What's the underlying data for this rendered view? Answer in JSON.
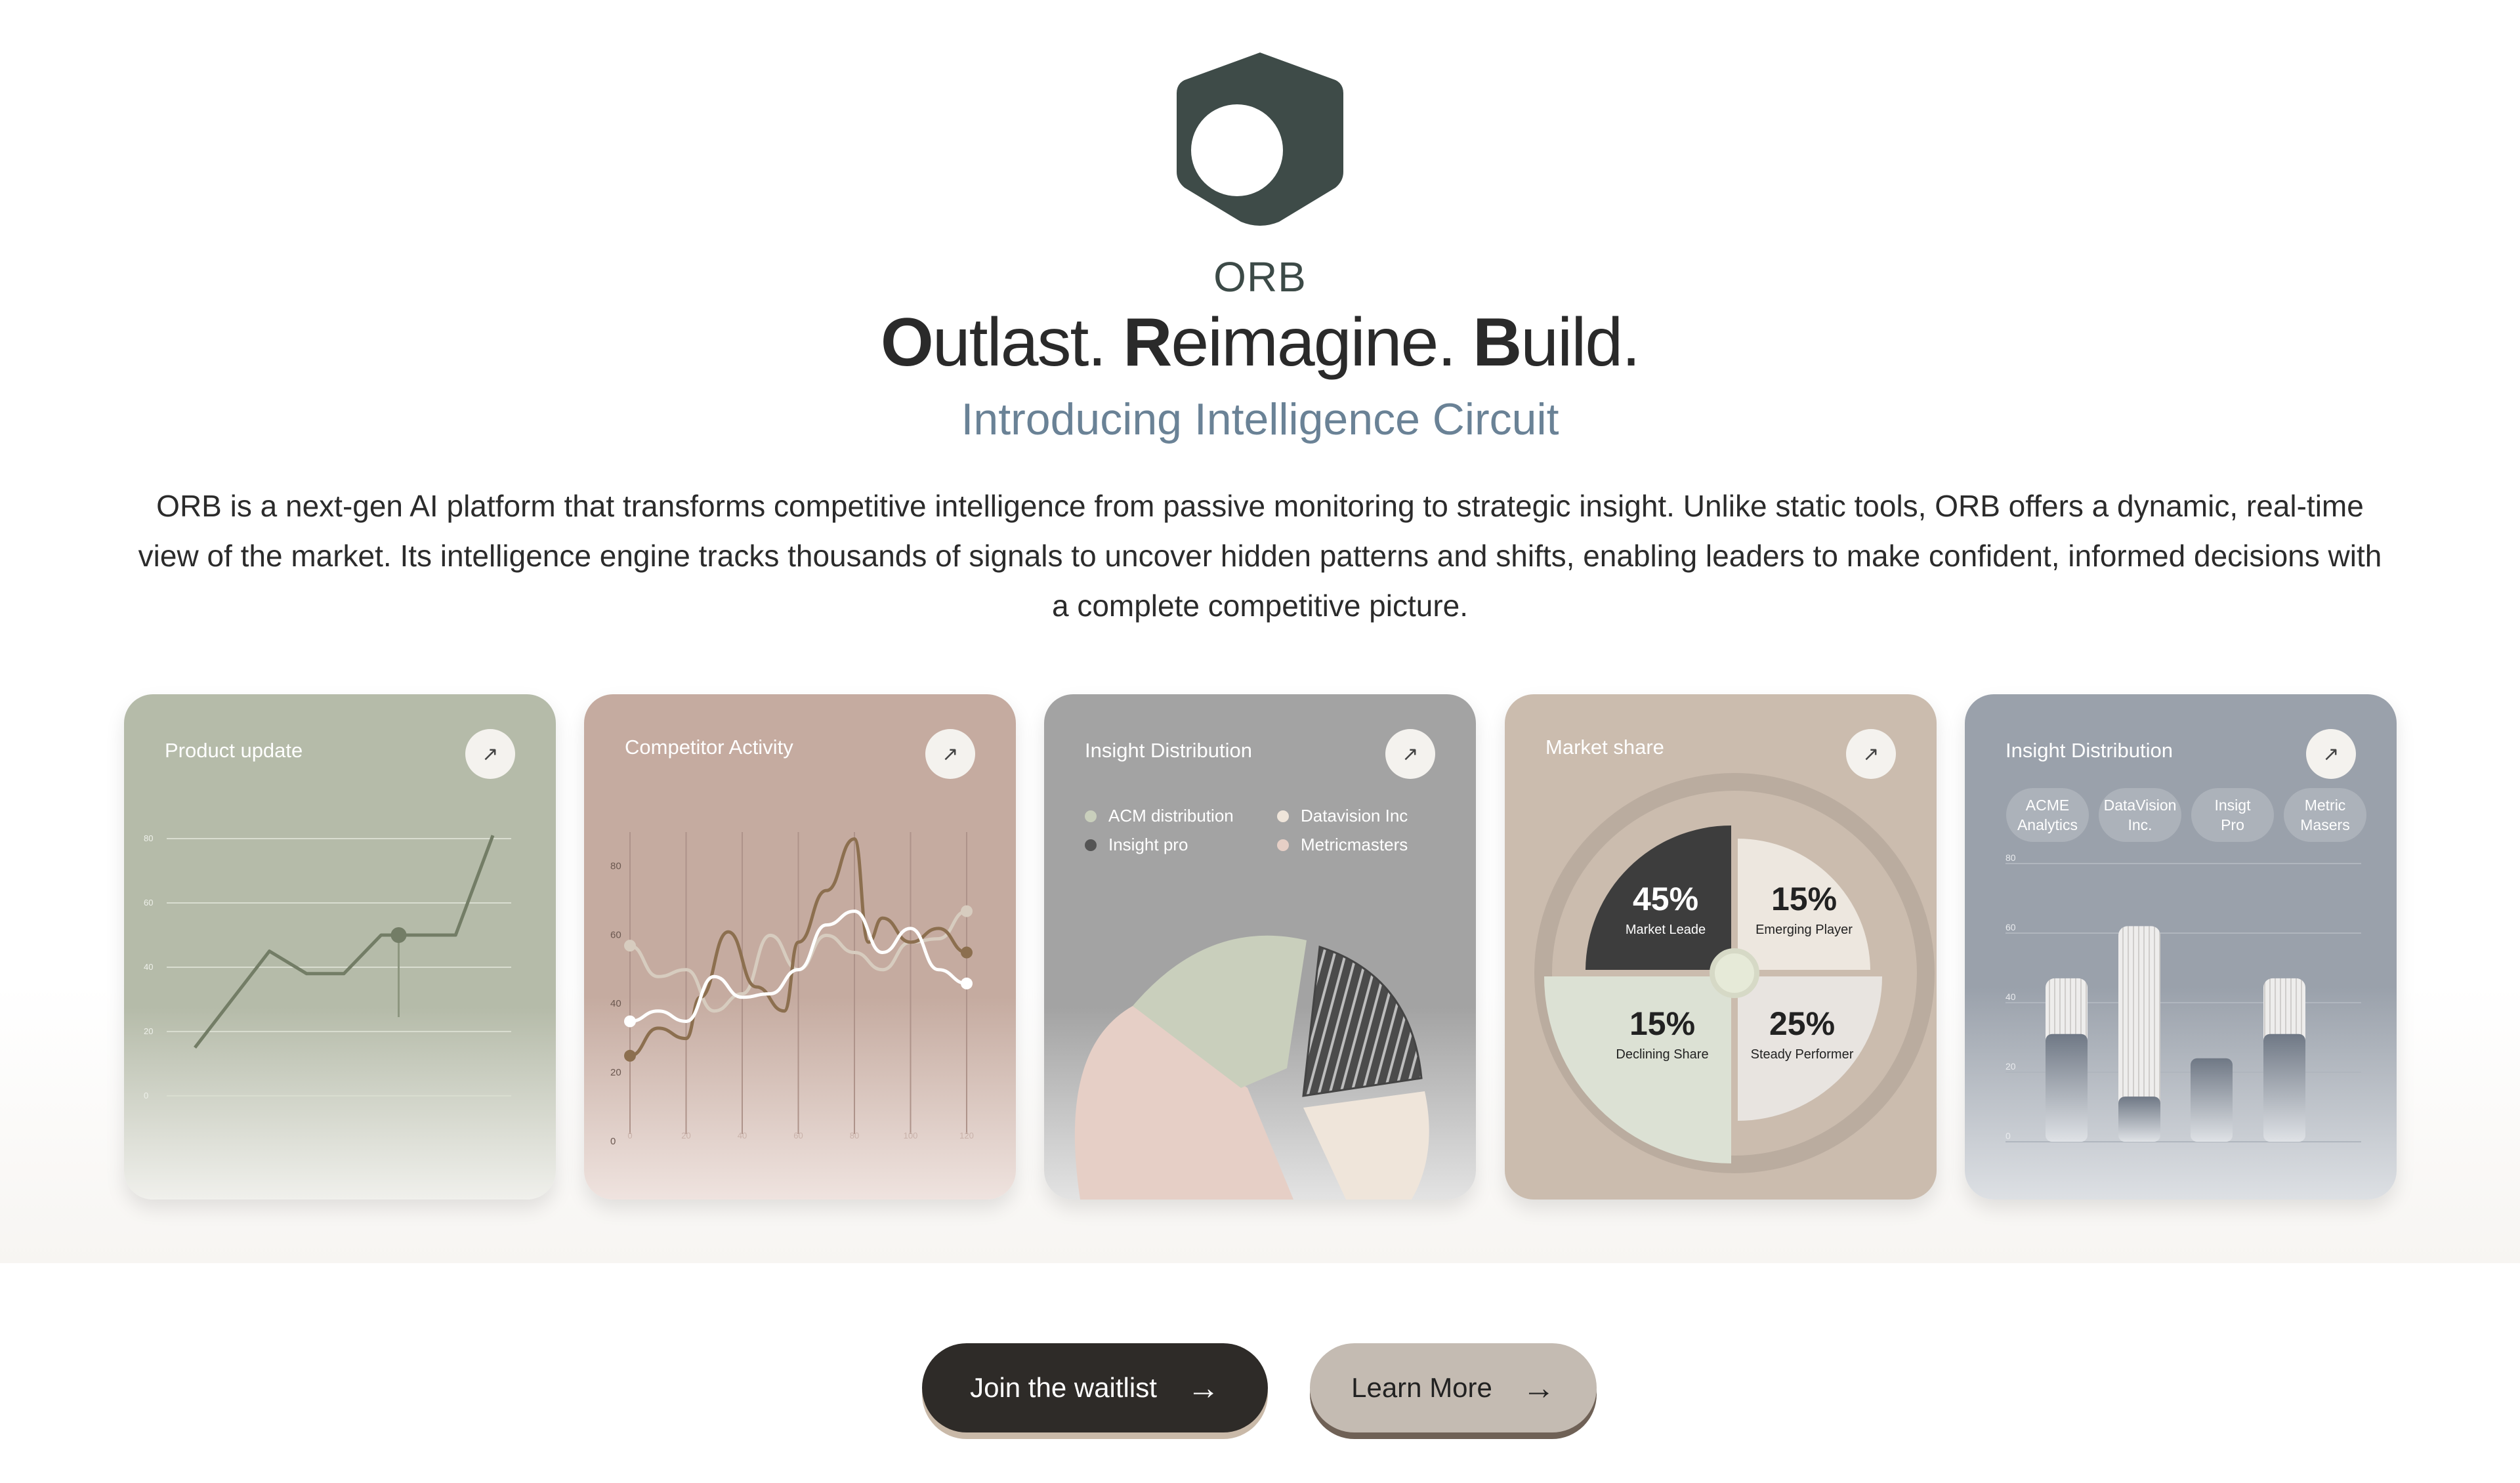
{
  "brand": {
    "name": "ORB",
    "logo_icon": "hexagon-ring-logo",
    "logo_color": "#3e4b48"
  },
  "headline": {
    "w1_initial": "O",
    "w1_rest": "utlast.",
    "w2_initial": "R",
    "w2_rest": "eimagine.",
    "w3_initial": "B",
    "w3_rest": "uild."
  },
  "subheadline": "Introducing Intelligence Circuit",
  "description": "ORB is a next-gen AI platform that transforms competitive intelligence from passive monitoring to strategic insight. Unlike static tools, ORB offers a dynamic, real-time view of the market. Its intelligence engine tracks thousands of signals to uncover hidden patterns and shifts, enabling leaders to make confident, informed decisions with a complete competitive picture.",
  "cards": {
    "product_update": {
      "title": "Product update",
      "icon": "arrow-up-right-icon",
      "chart_data": {
        "type": "line",
        "y_ticks": [
          "80",
          "60",
          "40",
          "20",
          "0"
        ],
        "ylim": [
          0,
          80
        ],
        "x": [
          0,
          1,
          2,
          3,
          4,
          5,
          6,
          7,
          8
        ],
        "values": [
          15,
          30,
          45,
          38,
          38,
          50,
          50,
          50,
          81
        ],
        "grid": true
      }
    },
    "competitor_activity": {
      "title": "Competitor Activity",
      "icon": "arrow-up-right-icon",
      "chart_data": {
        "type": "line",
        "x_ticks": [
          "0",
          "20",
          "40",
          "60",
          "80",
          "100",
          "120"
        ],
        "y_ticks": [
          "80",
          "60",
          "40",
          "20",
          "0"
        ],
        "xlim": [
          0,
          120
        ],
        "ylim": [
          0,
          90
        ],
        "series": [
          {
            "color": "#8c6f4f",
            "x": [
              0,
              10,
              20,
              25,
              35,
              45,
              55,
              60,
              70,
              80,
              85,
              90,
              100,
              110,
              120
            ],
            "values": [
              25,
              33,
              30,
              42,
              61,
              45,
              38,
              58,
              73,
              88,
              58,
              65,
              58,
              62,
              55
            ]
          },
          {
            "color": "#ffffff",
            "x": [
              0,
              10,
              20,
              30,
              40,
              50,
              60,
              70,
              80,
              90,
              100,
              110,
              120
            ],
            "values": [
              35,
              38,
              35,
              48,
              42,
              43,
              50,
              63,
              67,
              55,
              62,
              50,
              46
            ]
          },
          {
            "color": "#d7ccbf",
            "x": [
              0,
              10,
              20,
              30,
              40,
              50,
              60,
              70,
              80,
              90,
              100,
              110,
              120
            ],
            "values": [
              57,
              48,
              50,
              38,
              43,
              60,
              50,
              60,
              55,
              50,
              58,
              59,
              67
            ]
          }
        ],
        "grid": true
      }
    },
    "insight_distribution": {
      "title": "Insight Distribution",
      "icon": "arrow-up-right-icon",
      "chart_data": {
        "type": "pie",
        "series": [
          {
            "name": "ACM distribution",
            "color": "#c9cfbc"
          },
          {
            "name": "Datavision Inc",
            "color": "#efe5da"
          },
          {
            "name": "Insight pro",
            "color": "#555555"
          },
          {
            "name": "Metricmasters",
            "color": "#e6cfc6"
          }
        ]
      }
    },
    "market_share": {
      "title": "Market share",
      "icon": "arrow-up-right-icon",
      "chart_data": {
        "type": "pie",
        "slices": [
          {
            "value": "45%",
            "label": "Market Leade",
            "color": "#3d3d3d"
          },
          {
            "value": "15%",
            "label": "Emerging Player",
            "color": "#ede7df"
          },
          {
            "value": "15%",
            "label": "Declining Share",
            "color": "#dce1d4"
          },
          {
            "value": "25%",
            "label": "Steady Performer",
            "color": "#e8e4e0"
          }
        ]
      }
    },
    "insight_distribution_2": {
      "title": "Insight Distribution",
      "icon": "arrow-up-right-icon",
      "pills": [
        {
          "line1": "ACME",
          "line2": "Analytics"
        },
        {
          "line1": "DataVision",
          "line2": "Inc."
        },
        {
          "line1": "Insigt",
          "line2": "Pro"
        },
        {
          "line1": "Metric",
          "line2": "Masers"
        }
      ],
      "chart_data": {
        "type": "bar",
        "y_ticks": [
          "80",
          "60",
          "40",
          "20",
          "0"
        ],
        "ylim": [
          0,
          80
        ],
        "categories": [
          "ACME Analytics",
          "DataVision Inc.",
          "Insigt Pro",
          "Metric Masers"
        ],
        "series": [
          {
            "values": [
              31,
              13,
              24,
              31
            ]
          },
          {
            "values": [
              47,
              62,
              24,
              47
            ]
          }
        ]
      }
    }
  },
  "buttons": {
    "waitlist": {
      "label": "Join the waitlist",
      "icon": "arrow-right-icon"
    },
    "learn_more": {
      "label": "Learn More",
      "icon": "arrow-right-icon"
    }
  }
}
